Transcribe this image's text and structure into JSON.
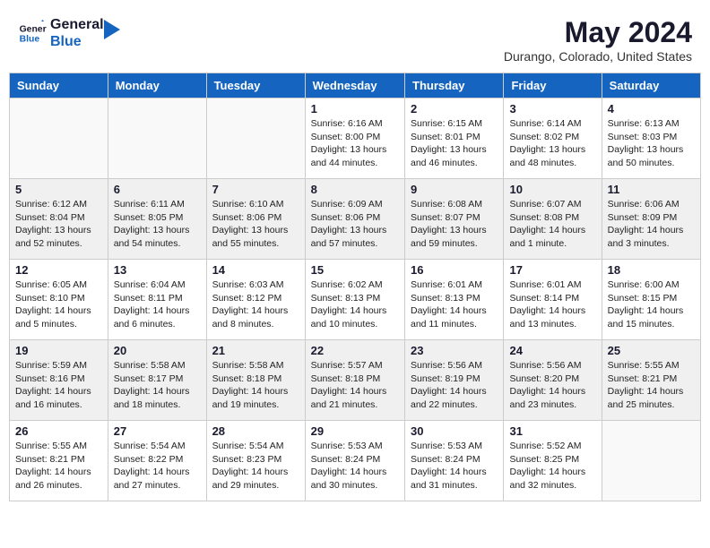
{
  "logo": {
    "line1": "General",
    "line2": "Blue"
  },
  "title": {
    "month_year": "May 2024",
    "location": "Durango, Colorado, United States"
  },
  "weekdays": [
    "Sunday",
    "Monday",
    "Tuesday",
    "Wednesday",
    "Thursday",
    "Friday",
    "Saturday"
  ],
  "weeks": [
    [
      {
        "day": "",
        "sunrise": "",
        "sunset": "",
        "daylight": ""
      },
      {
        "day": "",
        "sunrise": "",
        "sunset": "",
        "daylight": ""
      },
      {
        "day": "",
        "sunrise": "",
        "sunset": "",
        "daylight": ""
      },
      {
        "day": "1",
        "sunrise": "Sunrise: 6:16 AM",
        "sunset": "Sunset: 8:00 PM",
        "daylight": "Daylight: 13 hours and 44 minutes."
      },
      {
        "day": "2",
        "sunrise": "Sunrise: 6:15 AM",
        "sunset": "Sunset: 8:01 PM",
        "daylight": "Daylight: 13 hours and 46 minutes."
      },
      {
        "day": "3",
        "sunrise": "Sunrise: 6:14 AM",
        "sunset": "Sunset: 8:02 PM",
        "daylight": "Daylight: 13 hours and 48 minutes."
      },
      {
        "day": "4",
        "sunrise": "Sunrise: 6:13 AM",
        "sunset": "Sunset: 8:03 PM",
        "daylight": "Daylight: 13 hours and 50 minutes."
      }
    ],
    [
      {
        "day": "5",
        "sunrise": "Sunrise: 6:12 AM",
        "sunset": "Sunset: 8:04 PM",
        "daylight": "Daylight: 13 hours and 52 minutes."
      },
      {
        "day": "6",
        "sunrise": "Sunrise: 6:11 AM",
        "sunset": "Sunset: 8:05 PM",
        "daylight": "Daylight: 13 hours and 54 minutes."
      },
      {
        "day": "7",
        "sunrise": "Sunrise: 6:10 AM",
        "sunset": "Sunset: 8:06 PM",
        "daylight": "Daylight: 13 hours and 55 minutes."
      },
      {
        "day": "8",
        "sunrise": "Sunrise: 6:09 AM",
        "sunset": "Sunset: 8:06 PM",
        "daylight": "Daylight: 13 hours and 57 minutes."
      },
      {
        "day": "9",
        "sunrise": "Sunrise: 6:08 AM",
        "sunset": "Sunset: 8:07 PM",
        "daylight": "Daylight: 13 hours and 59 minutes."
      },
      {
        "day": "10",
        "sunrise": "Sunrise: 6:07 AM",
        "sunset": "Sunset: 8:08 PM",
        "daylight": "Daylight: 14 hours and 1 minute."
      },
      {
        "day": "11",
        "sunrise": "Sunrise: 6:06 AM",
        "sunset": "Sunset: 8:09 PM",
        "daylight": "Daylight: 14 hours and 3 minutes."
      }
    ],
    [
      {
        "day": "12",
        "sunrise": "Sunrise: 6:05 AM",
        "sunset": "Sunset: 8:10 PM",
        "daylight": "Daylight: 14 hours and 5 minutes."
      },
      {
        "day": "13",
        "sunrise": "Sunrise: 6:04 AM",
        "sunset": "Sunset: 8:11 PM",
        "daylight": "Daylight: 14 hours and 6 minutes."
      },
      {
        "day": "14",
        "sunrise": "Sunrise: 6:03 AM",
        "sunset": "Sunset: 8:12 PM",
        "daylight": "Daylight: 14 hours and 8 minutes."
      },
      {
        "day": "15",
        "sunrise": "Sunrise: 6:02 AM",
        "sunset": "Sunset: 8:13 PM",
        "daylight": "Daylight: 14 hours and 10 minutes."
      },
      {
        "day": "16",
        "sunrise": "Sunrise: 6:01 AM",
        "sunset": "Sunset: 8:13 PM",
        "daylight": "Daylight: 14 hours and 11 minutes."
      },
      {
        "day": "17",
        "sunrise": "Sunrise: 6:01 AM",
        "sunset": "Sunset: 8:14 PM",
        "daylight": "Daylight: 14 hours and 13 minutes."
      },
      {
        "day": "18",
        "sunrise": "Sunrise: 6:00 AM",
        "sunset": "Sunset: 8:15 PM",
        "daylight": "Daylight: 14 hours and 15 minutes."
      }
    ],
    [
      {
        "day": "19",
        "sunrise": "Sunrise: 5:59 AM",
        "sunset": "Sunset: 8:16 PM",
        "daylight": "Daylight: 14 hours and 16 minutes."
      },
      {
        "day": "20",
        "sunrise": "Sunrise: 5:58 AM",
        "sunset": "Sunset: 8:17 PM",
        "daylight": "Daylight: 14 hours and 18 minutes."
      },
      {
        "day": "21",
        "sunrise": "Sunrise: 5:58 AM",
        "sunset": "Sunset: 8:18 PM",
        "daylight": "Daylight: 14 hours and 19 minutes."
      },
      {
        "day": "22",
        "sunrise": "Sunrise: 5:57 AM",
        "sunset": "Sunset: 8:18 PM",
        "daylight": "Daylight: 14 hours and 21 minutes."
      },
      {
        "day": "23",
        "sunrise": "Sunrise: 5:56 AM",
        "sunset": "Sunset: 8:19 PM",
        "daylight": "Daylight: 14 hours and 22 minutes."
      },
      {
        "day": "24",
        "sunrise": "Sunrise: 5:56 AM",
        "sunset": "Sunset: 8:20 PM",
        "daylight": "Daylight: 14 hours and 23 minutes."
      },
      {
        "day": "25",
        "sunrise": "Sunrise: 5:55 AM",
        "sunset": "Sunset: 8:21 PM",
        "daylight": "Daylight: 14 hours and 25 minutes."
      }
    ],
    [
      {
        "day": "26",
        "sunrise": "Sunrise: 5:55 AM",
        "sunset": "Sunset: 8:21 PM",
        "daylight": "Daylight: 14 hours and 26 minutes."
      },
      {
        "day": "27",
        "sunrise": "Sunrise: 5:54 AM",
        "sunset": "Sunset: 8:22 PM",
        "daylight": "Daylight: 14 hours and 27 minutes."
      },
      {
        "day": "28",
        "sunrise": "Sunrise: 5:54 AM",
        "sunset": "Sunset: 8:23 PM",
        "daylight": "Daylight: 14 hours and 29 minutes."
      },
      {
        "day": "29",
        "sunrise": "Sunrise: 5:53 AM",
        "sunset": "Sunset: 8:24 PM",
        "daylight": "Daylight: 14 hours and 30 minutes."
      },
      {
        "day": "30",
        "sunrise": "Sunrise: 5:53 AM",
        "sunset": "Sunset: 8:24 PM",
        "daylight": "Daylight: 14 hours and 31 minutes."
      },
      {
        "day": "31",
        "sunrise": "Sunrise: 5:52 AM",
        "sunset": "Sunset: 8:25 PM",
        "daylight": "Daylight: 14 hours and 32 minutes."
      },
      {
        "day": "",
        "sunrise": "",
        "sunset": "",
        "daylight": ""
      }
    ]
  ]
}
